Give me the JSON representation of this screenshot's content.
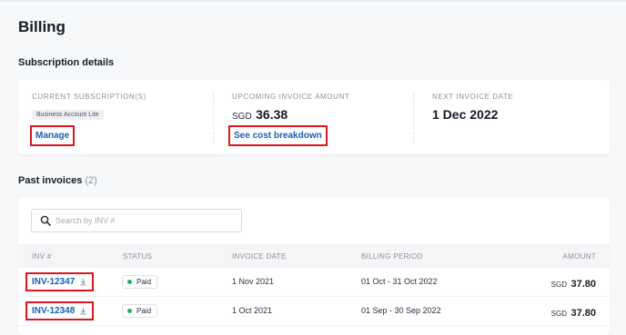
{
  "page": {
    "title": "Billing"
  },
  "subscription": {
    "section_title": "Subscription details",
    "current_label": "CURRENT SUBSCRIPTION(S)",
    "plan_name": "Business Account Lite",
    "manage_label": "Manage",
    "upcoming_label": "UPCOMING INVOICE AMOUNT",
    "upcoming_currency": "SGD",
    "upcoming_amount": "36.38",
    "breakdown_label": "See cost breakdown",
    "next_date_label": "NEXT INVOICE DATE",
    "next_date": "1 Dec 2022"
  },
  "invoices": {
    "section_title": "Past invoices",
    "count": "(2)",
    "search": {
      "placeholder": "Search by INV #",
      "value": "",
      "icon": "search-icon"
    },
    "columns": [
      "INV #",
      "STATUS",
      "INVOICE DATE",
      "BILLING PERIOD",
      "AMOUNT"
    ],
    "rows": [
      {
        "inv": "INV-12347",
        "status": "Paid",
        "invoice_date": "1 Nov 2021",
        "billing_period": "01 Oct - 31 Oct 2022",
        "currency": "SGD",
        "amount": "37.80"
      },
      {
        "inv": "INV-12348",
        "status": "Paid",
        "invoice_date": "1 Oct 2021",
        "billing_period": "01 Sep - 30 Sep 2022",
        "currency": "SGD",
        "amount": "37.80"
      }
    ]
  },
  "colors": {
    "link": "#1a5fb8",
    "highlight": "#e0141e",
    "paid": "#1fb25a"
  }
}
